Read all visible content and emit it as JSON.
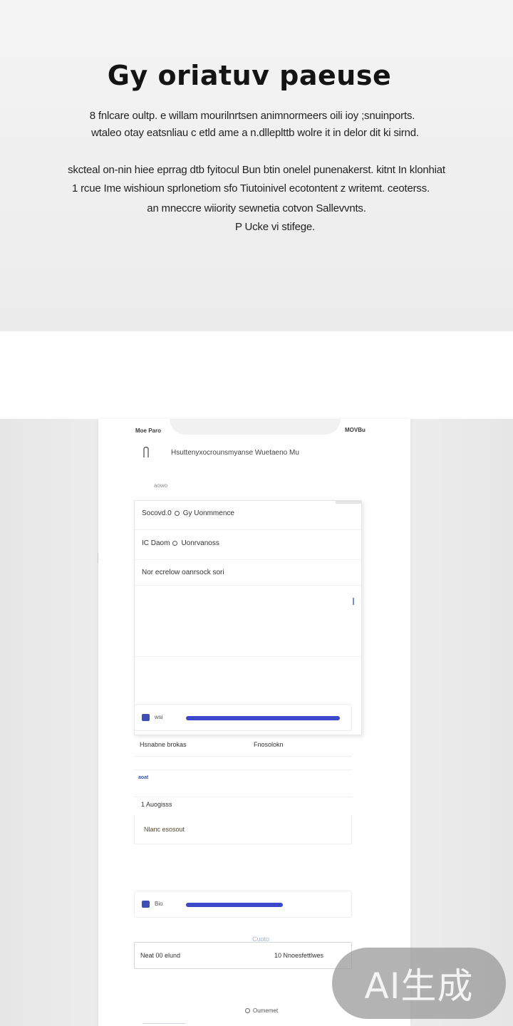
{
  "hero": {
    "title": "Gy oriatuv paeuse",
    "lines": [
      "8 fnlcare oultp. e willam mourilnrtsen animnormeers oili ioy ;snuinports.",
      "wtaleo otay eatsnliau c etld ame a n.dlleplttb wolre  it in  delor dit ki sirnd.",
      "skcteal on-nin hiee eprrag dtb fyitocul Bun btin onelel punenakerst. kitnt In klonhiat",
      "1 rcue Ime wishioun sprlonetiom sfo Tiutoinivel ecotontent z writemt. ceoterss.",
      "an mneccre wiiority sewnetia cotvon Sallevvnts.",
      "P Ucke vi stifege."
    ]
  },
  "phone": {
    "status_left": "Moe Paro",
    "status_right": "MOVBu",
    "header_text": "Hsuttenyxocrounsmyanse Wuetaeno Mu",
    "sub_link": "aowo",
    "card": {
      "rows": [
        {
          "left": "Socovd.0",
          "right": "Gy Uonmmence"
        },
        {
          "left": "IC Daom",
          "right": "Uonrvanoss"
        },
        {
          "left": "Nor ecrelow oanrsock sori",
          "right": ""
        }
      ]
    },
    "progress_rows": [
      {
        "label": "wsi",
        "value": 1.0
      },
      {
        "label": "Bio",
        "value": 0.63
      }
    ],
    "info_left": "Hsnabne brokas",
    "info_right": "Fnosolokn",
    "section_head": "aoat",
    "list_a": "1 Auogisss",
    "list_b": "Nlanc esosout",
    "faint_link": "Cuoto",
    "bottom_field_left": "Neat 00 elund",
    "bottom_field_right": "10  Nnoesfettlwes",
    "bottom_link": "Oumemet"
  },
  "watermark": "AI生成",
  "colors": {
    "accent": "#3b48c9",
    "section_head": "#3654b3",
    "hero_bg": "#efefef"
  }
}
